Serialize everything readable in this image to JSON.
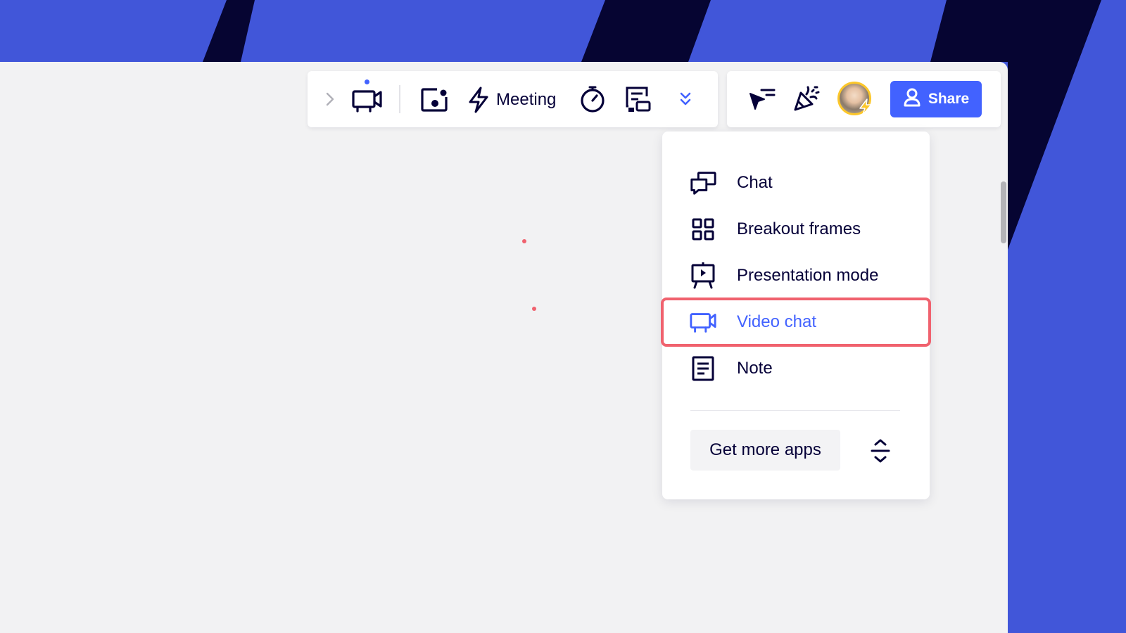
{
  "toolbar": {
    "meeting_label": "Meeting",
    "share_label": "Share",
    "icons": {
      "expand": "chevron-right-icon",
      "video": "video-camera-icon",
      "frame": "screen-record-icon",
      "meeting": "lightning-icon",
      "timer": "stopwatch-icon",
      "voting": "presentation-board-icon",
      "more": "double-chevron-down-icon",
      "reactions": "cursor-reactions-icon",
      "celebrate": "party-popper-icon",
      "share": "user-icon"
    }
  },
  "dropdown": {
    "items": [
      {
        "label": "Chat",
        "icon": "chat-icon"
      },
      {
        "label": "Breakout frames",
        "icon": "grid-icon"
      },
      {
        "label": "Presentation mode",
        "icon": "presentation-icon"
      },
      {
        "label": "Video chat",
        "icon": "video-chat-icon",
        "highlighted": true
      },
      {
        "label": "Note",
        "icon": "note-icon"
      }
    ],
    "more_apps_label": "Get more apps"
  },
  "colors": {
    "accent": "#4262ff",
    "background": "#4156d9",
    "canvas": "#f2f2f3",
    "highlight_outline": "#f0626e",
    "text": "#050038"
  }
}
